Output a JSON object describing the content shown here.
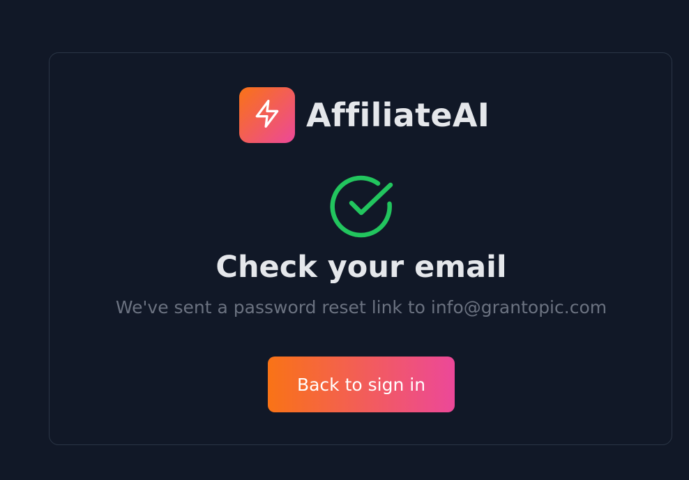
{
  "brand": {
    "name": "AffiliateAI",
    "logo_icon": "lightning-bolt-icon"
  },
  "status": {
    "icon": "check-circle-icon",
    "title": "Check your email",
    "message": "We've sent a password reset link to info@grantopic.com"
  },
  "actions": {
    "back_label": "Back to sign in"
  },
  "colors": {
    "background": "#111827",
    "card_border": "#2b3646",
    "accent_start": "#f97316",
    "accent_end": "#ec4899",
    "success": "#22c55e",
    "text_primary": "#e5e7eb",
    "text_muted": "#6b7280"
  }
}
